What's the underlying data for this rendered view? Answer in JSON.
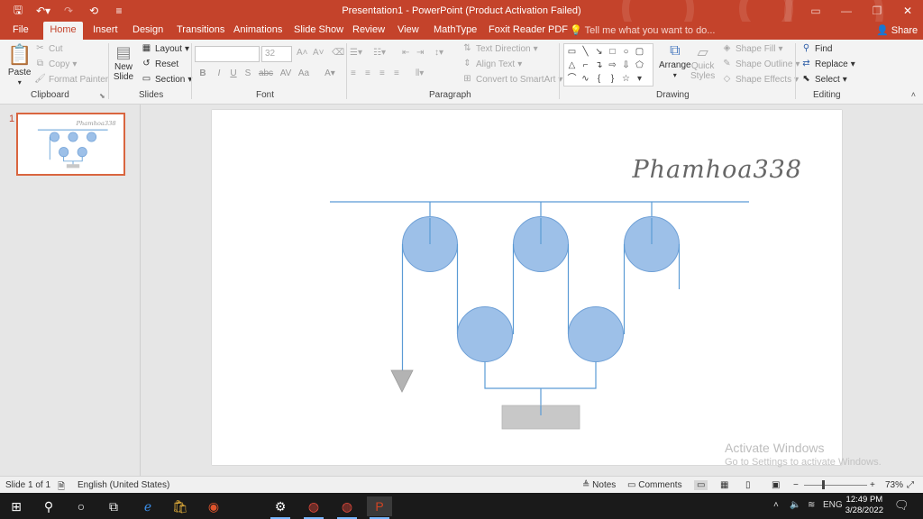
{
  "titlebar": {
    "title": "Presentation1 - PowerPoint (Product Activation Failed)",
    "qat": [
      {
        "icon": "save-icon",
        "glyph": "🖫"
      },
      {
        "icon": "undo-icon",
        "glyph": "↶▾"
      },
      {
        "icon": "redo-icon",
        "glyph": "↷"
      },
      {
        "icon": "present-icon",
        "glyph": "⟲"
      },
      {
        "icon": "customize-qat-icon",
        "glyph": "≡"
      }
    ]
  },
  "tabs": [
    "File",
    "Home",
    "Insert",
    "Design",
    "Transitions",
    "Animations",
    "Slide Show",
    "Review",
    "View",
    "MathType",
    "Foxit Reader PDF"
  ],
  "active_tab": "Home",
  "tell_me": "Tell me what you want to do...",
  "share": "Share",
  "ribbon": {
    "clipboard": {
      "label": "Clipboard",
      "paste": "Paste",
      "cut": "Cut",
      "copy": "Copy",
      "format_painter": "Format Painter"
    },
    "slides": {
      "label": "Slides",
      "new_slide": "New",
      "new_slide_2": "Slide",
      "layout": "Layout",
      "reset": "Reset",
      "section": "Section"
    },
    "font": {
      "label": "Font",
      "font_name": "",
      "font_size": "32"
    },
    "paragraph": {
      "label": "Paragraph",
      "text_direction": "Text Direction",
      "align_text": "Align Text",
      "convert_smartart": "Convert to SmartArt"
    },
    "drawing": {
      "label": "Drawing",
      "arrange": "Arrange",
      "quick_styles": "Quick",
      "quick_styles_2": "Styles",
      "shape_fill": "Shape Fill",
      "shape_outline": "Shape Outline",
      "shape_effects": "Shape Effects"
    },
    "editing": {
      "label": "Editing",
      "find": "Find",
      "replace": "Replace",
      "select": "Select"
    }
  },
  "thumbnail": {
    "number": "1"
  },
  "slide": {
    "signature": "Phamhoa338",
    "colors": {
      "pulley_fill": "#9dc0e8",
      "pulley_stroke": "#6d9fd6",
      "line": "#5b9bd5",
      "weight": "#c8c8c8"
    }
  },
  "watermark": {
    "line1": "Activate Windows",
    "line2": "Go to Settings to activate Windows."
  },
  "statusbar": {
    "slide_info": "Slide 1 of 1",
    "language": "English (United States)",
    "notes": "Notes",
    "comments": "Comments",
    "zoom": "73%"
  },
  "taskbar": {
    "ime": "ENG",
    "time": "12:49 PM",
    "date": "3/28/2022"
  }
}
